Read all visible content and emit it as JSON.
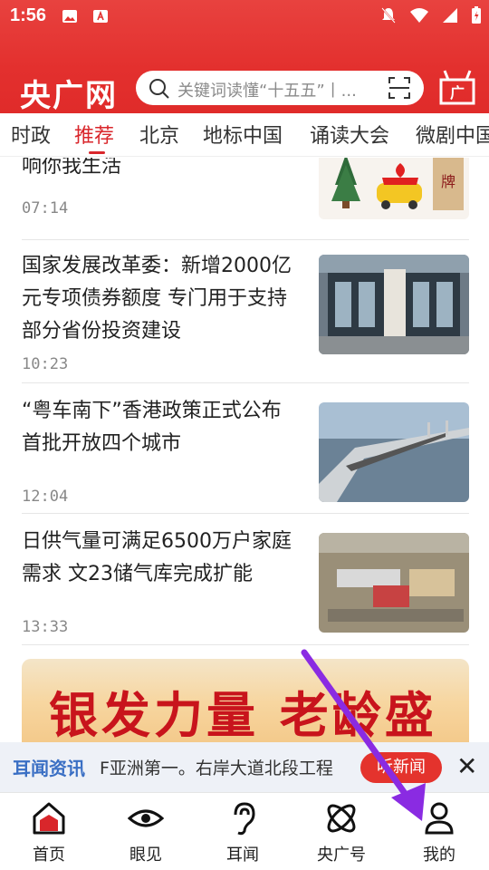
{
  "status": {
    "time": "1:56"
  },
  "header": {
    "logo": "央广网",
    "search_placeholder": "关键词读懂“十五五”丨..."
  },
  "tabs": [
    {
      "label": "时政"
    },
    {
      "label": "推荐"
    },
    {
      "label": "北京"
    },
    {
      "label": "地标中国"
    },
    {
      "label": "诵读大会"
    },
    {
      "label": "微剧中国"
    }
  ],
  "news": [
    {
      "title": "响你我生活",
      "time": "07:14"
    },
    {
      "title": "国家发展改革委：新增2000亿元专项债券额度  专门用于支持部分省份投资建设",
      "time": "10:23"
    },
    {
      "title": "“粤车南下”香港政策正式公布  首批开放四个城市",
      "time": "12:04"
    },
    {
      "title": "日供气量可满足6500万户家庭需求  文23储气库完成扩能",
      "time": "13:33"
    }
  ],
  "banner": {
    "text": "银发力量 老龄盛典"
  },
  "ticker": {
    "label": "耳闻资讯",
    "text": "F亚洲第一。右岸大道北段工程",
    "button": "听新闻",
    "close": "✕"
  },
  "bottom_nav": [
    {
      "label": "首页"
    },
    {
      "label": "眼见"
    },
    {
      "label": "耳闻"
    },
    {
      "label": "央广号"
    },
    {
      "label": "我的"
    }
  ],
  "colors": {
    "brand": "#e3302e",
    "accent": "#d9262b",
    "annotation_arrow": "#8a2be2"
  }
}
